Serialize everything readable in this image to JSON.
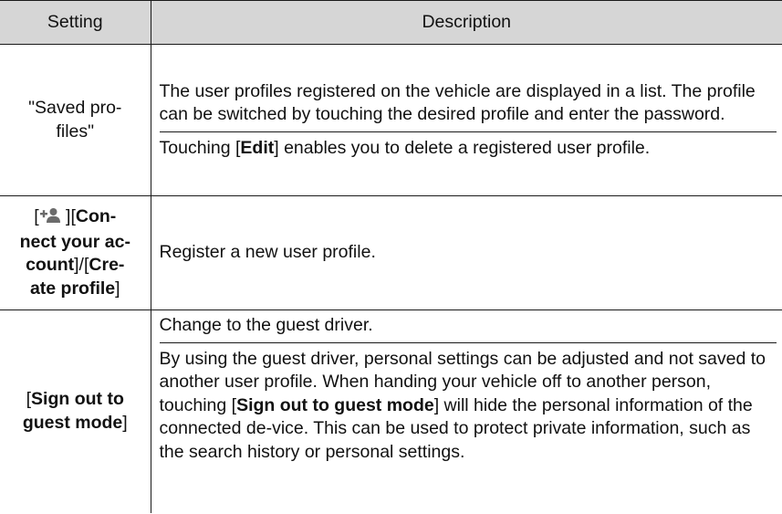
{
  "table": {
    "headers": {
      "setting": "Setting",
      "description": "Description"
    },
    "rows": [
      {
        "setting_line1": "\"Saved pro-",
        "setting_line2": "files\"",
        "desc1": "The user profiles registered on the vehicle are displayed in a list. The profile can be switched by touching the desired profile and enter the password.",
        "desc2_pre": "Touching [",
        "desc2_bold": "Edit",
        "desc2_post": "] enables you to delete a registered user profile."
      },
      {
        "setting_open": "[",
        "setting_icon": "add-user-icon",
        "setting_after_icon": " ][",
        "setting_bold1": "Con-",
        "setting_bold2": "nect your ac-",
        "setting_bold3": "count",
        "setting_mid": "]/[",
        "setting_bold4": "Cre-",
        "setting_bold5": "ate profile",
        "setting_close": "]",
        "desc1": "Register a new user profile."
      },
      {
        "setting_open": "[",
        "setting_bold1": "Sign out to",
        "setting_bold2": "guest mode",
        "setting_close": "]",
        "desc1": "Change to the guest driver.",
        "desc2_pre": "By using the guest driver, personal settings can be adjusted and not saved to another user profile. When handing your vehicle off to another person, touching [",
        "desc2_bold": "Sign out to guest mode",
        "desc2_post": "] will hide the personal information of the connected de-vice. This can be used to protect private information, such as the search history or personal settings."
      }
    ]
  },
  "colors": {
    "header_bg": "#d6d6d6",
    "border": "#1a1a1a",
    "icon": "#6b6b6b"
  }
}
